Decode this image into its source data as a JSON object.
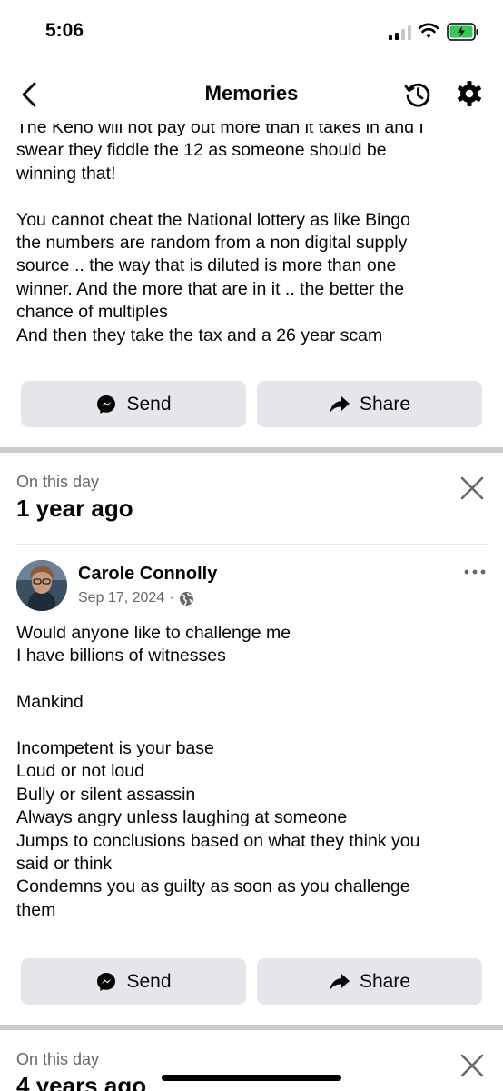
{
  "status_bar": {
    "time": "5:06"
  },
  "nav": {
    "title": "Memories"
  },
  "post_top": {
    "text": "The Keno will not pay out more than it takes in and I\nswear they fiddle the 12 as someone should be\nwinning that!\n\nYou cannot cheat the National lottery as like Bingo\nthe numbers are random from a non digital supply\nsource .. the way that is diluted is more than one\nwinner.  And the more that are in it .. the better the\nchance of multiples\nAnd then they take the tax and a 26 year scam",
    "send_label": "Send",
    "share_label": "Share"
  },
  "memory_1": {
    "label": "On this day",
    "heading": "1 year ago",
    "author": "Carole Connolly",
    "date": "Sep 17, 2024",
    "separator": "·",
    "text": "Would anyone like to challenge me\nI have billions of witnesses\n\nMankind\n\nIncompetent is your base\nLoud or not loud\nBully or silent assassin\nAlways angry unless laughing at someone\nJumps to conclusions based on what they think you\nsaid or think\nCondemns you as guilty as soon as you challenge\nthem",
    "send_label": "Send",
    "share_label": "Share"
  },
  "memory_2": {
    "label": "On this day",
    "heading": "4 years ago"
  },
  "icons": {
    "back": "chevron-left-icon",
    "history": "history-icon",
    "settings": "gear-icon",
    "send": "messenger-icon",
    "share": "share-arrow-icon",
    "close": "close-icon",
    "more": "more-horizontal-icon",
    "audience": "globe-icon"
  },
  "colors": {
    "button_bg": "#e4e6eb",
    "secondary_text": "#65676b",
    "divider": "#c9ccd1",
    "battery": "#34c759"
  }
}
